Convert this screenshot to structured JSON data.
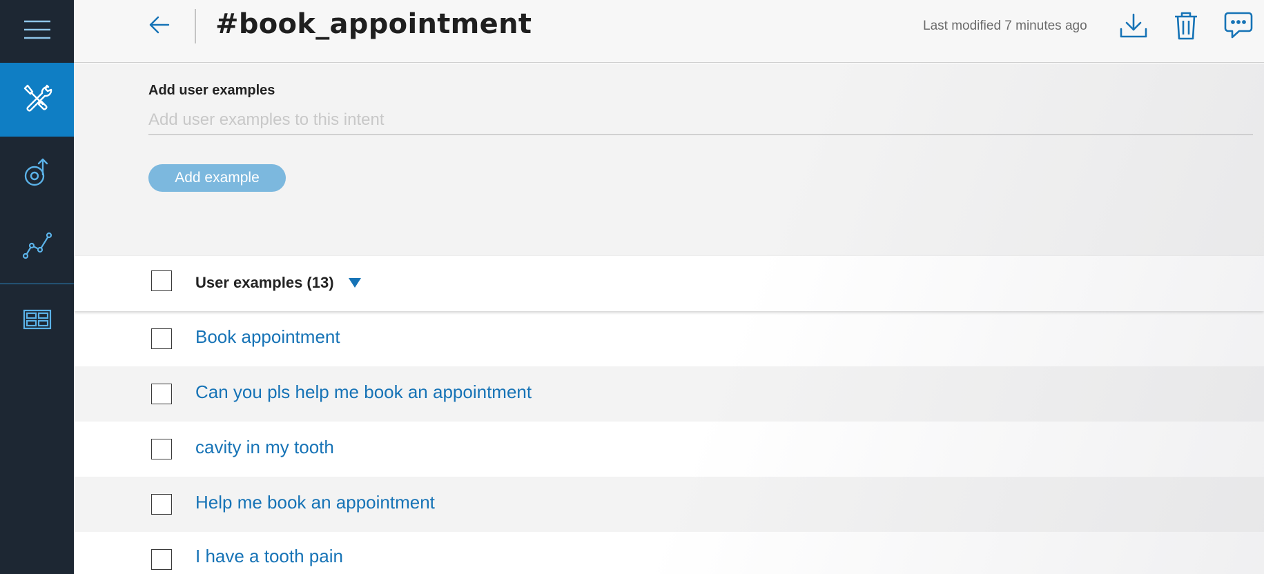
{
  "sidebar": {
    "items": [
      {
        "name": "menu",
        "icon": "hamburger-menu-icon"
      },
      {
        "name": "build",
        "icon": "wrench-screwdriver-icon",
        "active": true
      },
      {
        "name": "improve",
        "icon": "improve-arrow-icon"
      },
      {
        "name": "analytics",
        "icon": "line-chart-icon"
      },
      {
        "name": "content",
        "icon": "content-catalog-icon"
      }
    ]
  },
  "header": {
    "title": "#book_appointment",
    "last_modified": "Last modified 7 minutes ago"
  },
  "add_examples": {
    "label": "Add user examples",
    "placeholder": "Add user examples to this intent",
    "value": "",
    "button_label": "Add example"
  },
  "list": {
    "header_label": "User examples (13)",
    "rows": [
      {
        "text": "Book appointment"
      },
      {
        "text": "Can you pls help me book an appointment"
      },
      {
        "text": "cavity in my tooth"
      },
      {
        "text": "Help me book an appointment"
      },
      {
        "text": "I have a tooth pain"
      }
    ]
  },
  "colors": {
    "sidebar_bg": "#1d2733",
    "sidebar_active": "#0f7ec4",
    "accent": "#1673b6",
    "button_disabled": "#7cb8de"
  }
}
